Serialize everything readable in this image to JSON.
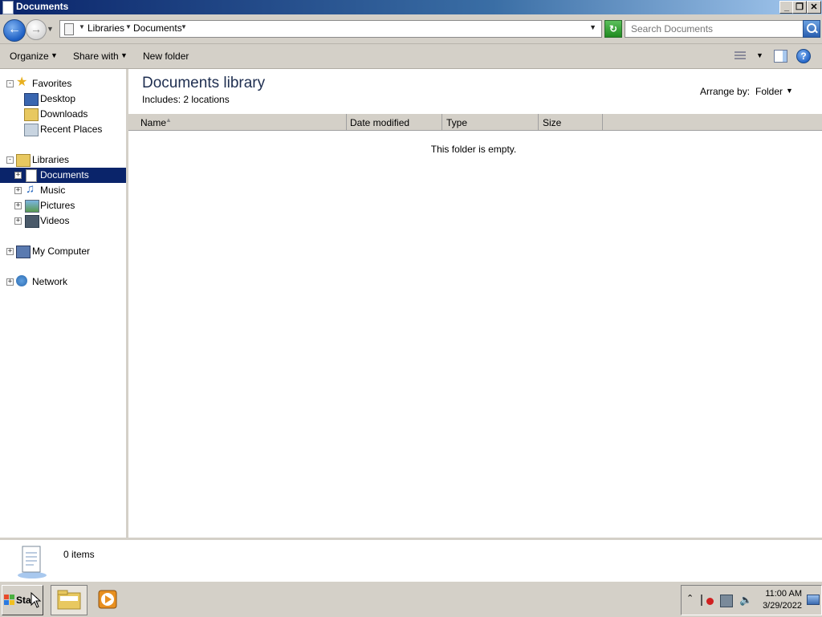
{
  "window": {
    "title": "Documents",
    "buttons": {
      "minimize": "_",
      "restore": "❐",
      "close": "✕"
    }
  },
  "address": {
    "crumbs": [
      "Libraries",
      "Documents"
    ],
    "search_placeholder": "Search Documents"
  },
  "toolbar": {
    "organize": "Organize",
    "share_with": "Share with",
    "new_folder": "New folder",
    "help": "?"
  },
  "nav": {
    "favorites": "Favorites",
    "desktop": "Desktop",
    "downloads": "Downloads",
    "recent_places": "Recent Places",
    "libraries": "Libraries",
    "documents": "Documents",
    "music": "Music",
    "pictures": "Pictures",
    "videos": "Videos",
    "my_computer": "My Computer",
    "network": "Network"
  },
  "content": {
    "title": "Documents library",
    "includes": "Includes:  2 locations",
    "arrange_label": "Arrange by:",
    "arrange_value": "Folder",
    "columns": [
      "Name",
      "Date modified",
      "Type",
      "Size"
    ],
    "empty_message": "This folder is empty."
  },
  "details": {
    "count": "0 items"
  },
  "taskbar": {
    "start_label": "Start",
    "time": "11:00 AM",
    "date": "3/29/2022"
  },
  "colors": {
    "title_bar": "#0a246a",
    "selection": "#0a246a",
    "chrome": "#d4d0c8"
  }
}
